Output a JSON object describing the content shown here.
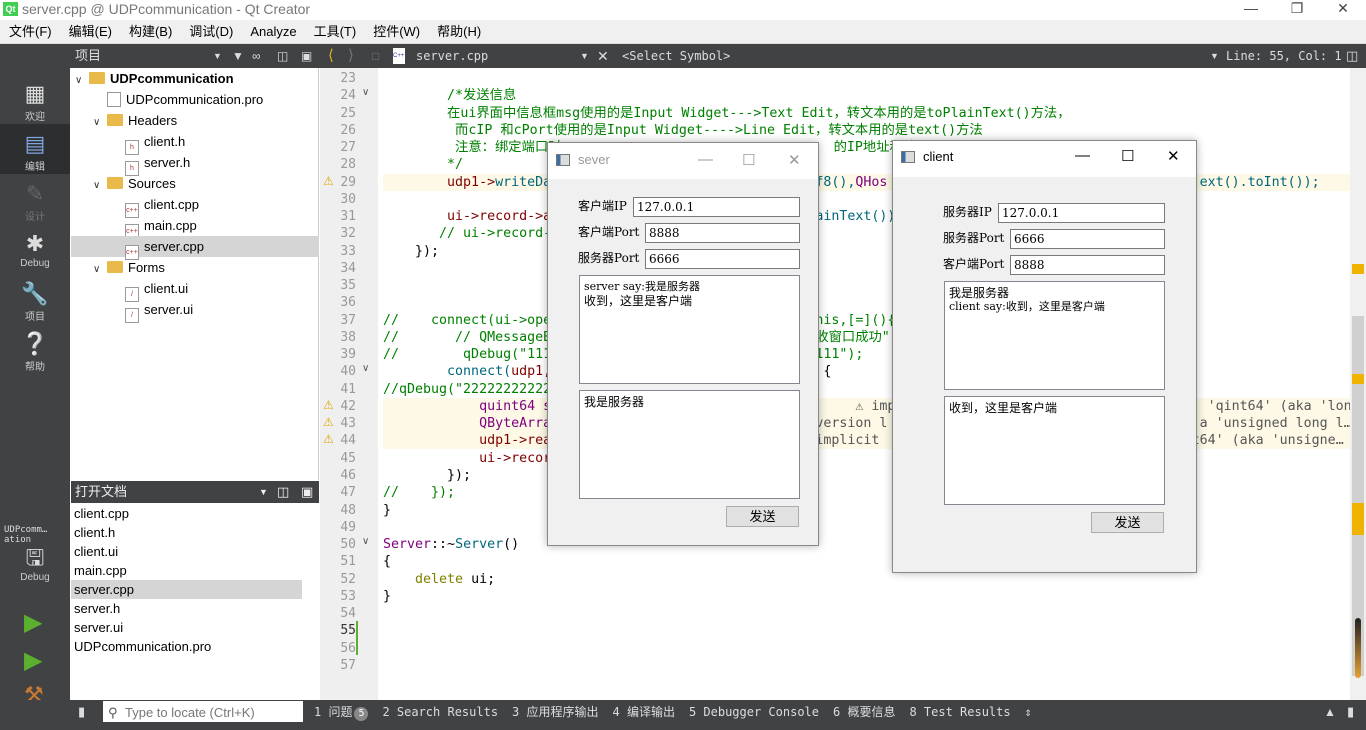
{
  "window_title": "server.cpp @ UDPcommunication - Qt Creator",
  "app_logo": "Qt",
  "window_controls": [
    "minimize-icon",
    "maximize-icon",
    "close-icon"
  ],
  "menu": [
    "文件(F)",
    "编辑(E)",
    "构建(B)",
    "调试(D)",
    "Analyze",
    "工具(T)",
    "控件(W)",
    "帮助(H)"
  ],
  "toolbar": {
    "pane_title": "项目",
    "file": "server.cpp",
    "symbol": "<Select Symbol>",
    "position": "Line: 55, Col: 1"
  },
  "modes": [
    {
      "label": "欢迎",
      "icon": "grid-icon"
    },
    {
      "label": "编辑",
      "icon": "edit-icon"
    },
    {
      "label": "设计",
      "icon": "pencil-icon"
    },
    {
      "label": "Debug",
      "icon": "bug-icon"
    },
    {
      "label": "项目",
      "icon": "wrench-icon"
    },
    {
      "label": "帮助",
      "icon": "help-icon"
    }
  ],
  "kit": {
    "project": "UDPcomm…ation",
    "label": "Debug"
  },
  "tree": [
    {
      "label": "UDPcommunication",
      "type": "project",
      "depth": 0,
      "expanded": true
    },
    {
      "label": "UDPcommunication.pro",
      "type": "pro",
      "depth": 1
    },
    {
      "label": "Headers",
      "type": "folder",
      "depth": 1,
      "expanded": true
    },
    {
      "label": "client.h",
      "type": "h",
      "depth": 2
    },
    {
      "label": "server.h",
      "type": "h",
      "depth": 2
    },
    {
      "label": "Sources",
      "type": "folder",
      "depth": 1,
      "expanded": true
    },
    {
      "label": "client.cpp",
      "type": "cpp",
      "depth": 2
    },
    {
      "label": "main.cpp",
      "type": "cpp",
      "depth": 2
    },
    {
      "label": "server.cpp",
      "type": "cpp",
      "depth": 2,
      "selected": true
    },
    {
      "label": "Forms",
      "type": "folder",
      "depth": 1,
      "expanded": true
    },
    {
      "label": "client.ui",
      "type": "ui",
      "depth": 2
    },
    {
      "label": "server.ui",
      "type": "ui",
      "depth": 2
    }
  ],
  "open_docs": {
    "title": "打开文档",
    "items": [
      "client.cpp",
      "client.h",
      "client.ui",
      "main.cpp",
      "server.cpp",
      "server.h",
      "server.ui",
      "UDPcommunication.pro"
    ],
    "selected": "server.cpp"
  },
  "code": [
    {
      "n": 23,
      "seg": []
    },
    {
      "n": 24,
      "fold": true,
      "seg": [
        [
          "        /*发送信息",
          "cm"
        ]
      ]
    },
    {
      "n": 25,
      "seg": [
        [
          "        在ui界面中信息框msg使用的是Input Widget--->Text Edit，转文本用的是toPlainText()方法，",
          "cm"
        ]
      ]
    },
    {
      "n": 26,
      "seg": [
        [
          "         而cIP 和cPort使用的是Input Widget---->Line Edit，转文本用的是text()方法",
          "cm"
        ]
      ]
    },
    {
      "n": 27,
      "seg": [
        [
          "         注意：绑定端口时                                  的IP地址和端",
          "cm"
        ]
      ]
    },
    {
      "n": 28,
      "seg": [
        [
          "        */",
          "cm"
        ]
      ]
    },
    {
      "n": 29,
      "warn": true,
      "seg": [
        [
          "        udp1->",
          "mem"
        ],
        [
          "writeDa",
          "fn"
        ],
        [
          "                                ",
          ""
        ],
        [
          "tf8(),",
          "fn"
        ],
        [
          "QHos",
          "ty"
        ],
        [
          "                                       ",
          ""
        ],
        [
          "ext().toInt());",
          "fn"
        ]
      ]
    },
    {
      "n": 30,
      "seg": []
    },
    {
      "n": 31,
      "seg": [
        [
          "        ui->",
          "mem"
        ],
        [
          "record->a",
          "mem"
        ],
        [
          "                                 ",
          ""
        ],
        [
          "ainText())",
          "fn"
        ]
      ]
    },
    {
      "n": 32,
      "seg": [
        [
          "       // ui->record-",
          "cm"
        ]
      ]
    },
    {
      "n": 33,
      "seg": [
        [
          "    });",
          ""
        ]
      ]
    },
    {
      "n": 34,
      "seg": []
    },
    {
      "n": 35,
      "seg": []
    },
    {
      "n": 36,
      "seg": []
    },
    {
      "n": 37,
      "seg": [
        [
          "//    connect(ui->ope",
          "cm"
        ],
        [
          "                                 ",
          ""
        ],
        [
          "his,[=](){",
          "cm"
        ]
      ]
    },
    {
      "n": 38,
      "seg": [
        [
          "//       // QMessageB",
          "cm"
        ],
        [
          "                                 ",
          ""
        ],
        [
          "收窗口成功\")",
          "cm"
        ]
      ]
    },
    {
      "n": 39,
      "seg": [
        [
          "//        qDebug(\"111",
          "cm"
        ],
        [
          "                                 ",
          ""
        ],
        [
          "111\");",
          "cm"
        ]
      ]
    },
    {
      "n": 40,
      "fold": true,
      "seg": [
        [
          "        connect(",
          "fn"
        ],
        [
          "udp1,",
          "mem"
        ],
        [
          "                                  ",
          ""
        ],
        [
          "{",
          ""
        ]
      ]
    },
    {
      "n": 41,
      "seg": [
        [
          "//qDebug(\"22222222222",
          "cm"
        ]
      ]
    },
    {
      "n": 42,
      "warn": true,
      "seg": [
        [
          "            quint64 s",
          "ty"
        ],
        [
          "                                ",
          ""
        ],
        [
          ";     ⚠ imp",
          "wt"
        ],
        [
          "                                       ",
          ""
        ],
        [
          "'qint64' (aka 'lon…",
          "wt"
        ]
      ]
    },
    {
      "n": 43,
      "warn": true,
      "seg": [
        [
          "            QByteArra",
          "ty"
        ],
        [
          "                                ",
          ""
        ],
        [
          "nversion l",
          "wt"
        ],
        [
          "                                       ",
          ""
        ],
        [
          "a 'unsigned long l…",
          "wt"
        ]
      ]
    },
    {
      "n": 44,
      "warn": true,
      "seg": [
        [
          "            udp1->rea",
          "mem"
        ],
        [
          "                                ",
          ""
        ],
        [
          "⚠implicit",
          "wt"
        ],
        [
          "                                       ",
          ""
        ],
        [
          "t64' (aka 'unsigne…",
          "wt"
        ]
      ]
    },
    {
      "n": 45,
      "seg": [
        [
          "            ui->recor",
          "mem"
        ]
      ]
    },
    {
      "n": 46,
      "seg": [
        [
          "        });",
          ""
        ]
      ]
    },
    {
      "n": 47,
      "seg": [
        [
          "//    });",
          "cm"
        ]
      ]
    },
    {
      "n": 48,
      "seg": [
        [
          "}",
          ""
        ]
      ]
    },
    {
      "n": 49,
      "seg": []
    },
    {
      "n": 50,
      "fold": true,
      "seg": [
        [
          "Server",
          "ty"
        ],
        [
          "::~",
          ""
        ],
        [
          "Server",
          "fn"
        ],
        [
          "()",
          ""
        ]
      ]
    },
    {
      "n": 51,
      "seg": [
        [
          "{",
          ""
        ]
      ]
    },
    {
      "n": 52,
      "seg": [
        [
          "    ",
          ""
        ],
        [
          "delete",
          "kw"
        ],
        [
          " ui;",
          ""
        ]
      ]
    },
    {
      "n": 53,
      "seg": [
        [
          "}",
          ""
        ]
      ]
    },
    {
      "n": 54,
      "seg": []
    },
    {
      "n": 55,
      "cur": true,
      "seg": []
    },
    {
      "n": 56,
      "seg": []
    },
    {
      "n": 57,
      "seg": []
    }
  ],
  "sever_window": {
    "title": "sever",
    "client_ip_label": "客户端IP",
    "client_ip": "127.0.0.1",
    "client_port_label": "客户端Port",
    "client_port": "8888",
    "server_port_label": "服务器Port",
    "server_port": "6666",
    "record_line1": "server say:我是服务器",
    "record_line2": "收到，这里是客户端",
    "message": "我是服务器",
    "send": "发送"
  },
  "client_window": {
    "title": "client",
    "server_ip_label": "服务器IP",
    "server_ip": "127.0.0.1",
    "server_port_label": "服务器Port",
    "server_port": "6666",
    "client_port_label": "客户端Port",
    "client_port": "8888",
    "record_line1": "我是服务器",
    "record_line2": "client say:收到，这里是客户端",
    "message": "收到，这里是客户端",
    "send": "发送"
  },
  "bottom": {
    "locate_placeholder": "Type to locate (Ctrl+K)",
    "tabs": [
      "1 问题",
      "2 Search Results",
      "3 应用程序输出",
      "4 编译输出",
      "5 Debugger Console",
      "6 概要信息",
      "8 Test Results"
    ],
    "issues_count": "5"
  }
}
